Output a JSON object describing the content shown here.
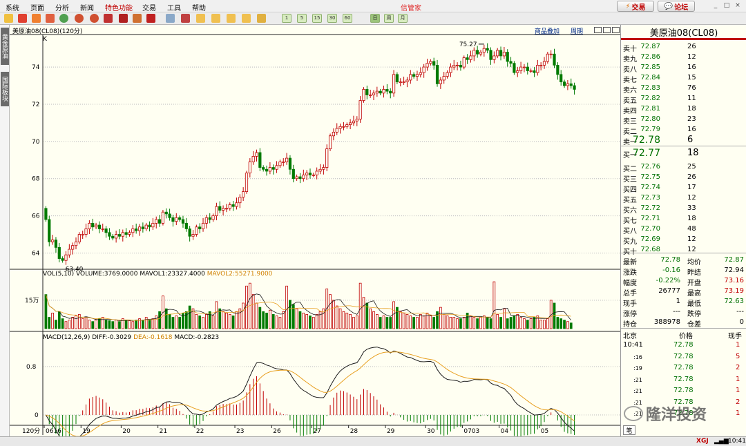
{
  "menu": {
    "items": [
      "系统",
      "页面",
      "分析",
      "新闻",
      "特色功能",
      "交易",
      "工具",
      "帮助"
    ],
    "brand": "信管家",
    "trade_btn": "交易",
    "forum_btn": "论坛",
    "win_controls": [
      "_",
      "□",
      "×"
    ]
  },
  "toolbar": {
    "period_buttons": [
      "1",
      "5",
      "15",
      "30",
      "60",
      "日",
      "周",
      "月"
    ],
    "icons": [
      "back-icon",
      "home-icon",
      "layers-icon",
      "stack-icon",
      "refresh-icon",
      "zoom-in-icon",
      "zoom-out-icon",
      "tv-icon",
      "pen-icon",
      "paint-icon",
      "funnel-icon",
      "table-icon",
      "chart-icon",
      "f10-icon",
      "list-icon",
      "news-icon",
      "doc-icon",
      "clock-icon"
    ]
  },
  "sidebar": {
    "tabs": [
      "黄金原油",
      "国际板块"
    ]
  },
  "chart": {
    "title": "美原油08(CL08)(120分)",
    "top_links": [
      "商品叠加",
      "周期"
    ],
    "k_label": "K",
    "period_label": "120分",
    "vol_legend_vol": "VOL(5,10)",
    "vol_legend_volume": "VOLUME:3769.0000",
    "vol_legend_mavol1": "MAVOL1:23327.4000",
    "vol_legend_mavol2": "MAVOL2:55271.9000",
    "macd_legend_title": "MACD(12,26,9)",
    "macd_legend_diff": "DIFF:-0.3029",
    "macd_legend_dea": "DEA:-0.1618",
    "macd_legend_macd": "MACD:-0.2823",
    "high_label": "75.27",
    "low_label": "63.40",
    "colors": {
      "up": "#c00000",
      "down": "#007a00",
      "ma1": "#1a1a1a",
      "ma2": "#e8a020"
    }
  },
  "chart_data": {
    "type": "candlestick",
    "ylim": [
      63.2,
      75.6
    ],
    "price_ticks": [
      "74",
      "72",
      "70",
      "68",
      "66",
      "64"
    ],
    "x_labels": [
      "0616",
      "19",
      "20",
      "21",
      "22",
      "23",
      "26",
      "27",
      "28",
      "29",
      "30",
      "0703",
      "04",
      "05"
    ],
    "volume_tick": "15万",
    "macd_ticks": [
      "0.8",
      "0"
    ],
    "close": [
      65.8,
      64.6,
      64.7,
      64.3,
      63.7,
      63.6,
      63.9,
      64.2,
      64.4,
      64.6,
      65.0,
      65.0,
      65.3,
      65.6,
      65.4,
      65.5,
      65.3,
      65.3,
      65.1,
      64.9,
      64.8,
      65.0,
      64.9,
      65.1,
      65.0,
      65.1,
      65.3,
      65.2,
      65.4,
      65.3,
      65.5,
      65.4,
      65.6,
      65.8,
      65.6,
      66.2,
      66.1,
      65.9,
      65.7,
      65.9,
      65.8,
      65.6,
      65.3,
      64.9,
      65.0,
      65.4,
      65.3,
      65.6,
      65.9,
      65.8,
      66.0,
      66.5,
      66.3,
      66.4,
      66.4,
      66.6,
      66.5,
      66.7,
      67.0,
      67.3,
      68.3,
      68.9,
      69.2,
      69.4,
      68.6,
      68.5,
      68.4,
      68.6,
      68.5,
      68.7,
      68.9,
      68.9,
      69.1,
      68.5,
      68.0,
      68.1,
      68.0,
      68.2,
      68.3,
      68.2,
      68.2,
      68.4,
      68.5,
      68.6,
      69.6,
      70.3,
      70.5,
      70.7,
      70.8,
      70.8,
      70.9,
      71.0,
      71.1,
      71.2,
      72.2,
      72.8,
      72.5,
      72.5,
      72.6,
      72.7,
      72.6,
      72.8,
      72.7,
      72.6,
      73.6,
      73.2,
      73.2,
      73.2,
      73.3,
      73.6,
      73.5,
      73.6,
      73.7,
      74.0,
      74.2,
      74.3,
      74.1,
      73.1,
      73.3,
      73.5,
      73.7,
      74.0,
      74.1,
      74.1,
      74.0,
      74.5,
      74.4,
      74.6,
      74.9,
      74.7,
      74.8,
      75.0,
      74.9,
      74.4,
      74.6,
      74.9,
      74.6,
      74.8,
      74.3,
      74.2,
      73.7,
      73.8,
      74.0,
      74.0,
      73.8,
      73.8,
      73.7,
      74.1,
      74.1,
      74.3,
      74.7,
      74.7,
      74.1,
      73.6,
      73.2,
      73.0,
      73.1,
      73.0,
      72.8
    ],
    "volume": [
      120,
      40,
      55,
      30,
      60,
      35,
      25,
      30,
      40,
      45,
      50,
      35,
      40,
      30,
      25,
      30,
      35,
      40,
      30,
      28,
      25,
      30,
      25,
      35,
      30,
      28,
      25,
      30,
      35,
      30,
      40,
      30,
      35,
      45,
      60,
      115,
      70,
      50,
      40,
      45,
      40,
      55,
      60,
      80,
      70,
      50,
      45,
      40,
      50,
      60,
      45,
      95,
      70,
      60,
      55,
      50,
      45,
      60,
      70,
      90,
      150,
      160,
      120,
      90,
      75,
      60,
      55,
      65,
      50,
      45,
      40,
      60,
      150,
      100,
      85,
      70,
      60,
      55,
      50,
      45,
      40,
      50,
      60,
      70,
      140,
      120,
      100,
      80,
      70,
      60,
      55,
      50,
      40,
      45,
      160,
      110,
      90,
      70,
      60,
      50,
      40,
      45,
      40,
      40,
      95,
      75,
      60,
      55,
      50,
      45,
      40,
      40,
      50,
      45,
      55,
      45,
      40,
      60,
      75,
      50,
      45,
      40,
      40,
      35,
      35,
      40,
      55,
      45,
      40,
      35,
      40,
      45,
      40,
      35,
      165,
      50,
      40,
      70,
      35,
      40,
      45,
      50,
      40,
      35,
      30,
      35,
      40,
      45,
      30,
      30,
      35,
      100,
      90,
      40,
      35,
      30,
      25,
      20
    ]
  },
  "quote": {
    "title": "美原油08(CL08)",
    "sell": [
      {
        "label": "卖十",
        "price": "72.87",
        "vol": "26"
      },
      {
        "label": "卖九",
        "price": "72.86",
        "vol": "12"
      },
      {
        "label": "卖八",
        "price": "72.85",
        "vol": "16"
      },
      {
        "label": "卖七",
        "price": "72.84",
        "vol": "15"
      },
      {
        "label": "卖六",
        "price": "72.83",
        "vol": "76"
      },
      {
        "label": "卖五",
        "price": "72.82",
        "vol": "11"
      },
      {
        "label": "卖四",
        "price": "72.81",
        "vol": "18"
      },
      {
        "label": "卖三",
        "price": "72.80",
        "vol": "23"
      },
      {
        "label": "卖二",
        "price": "72.79",
        "vol": "16"
      },
      {
        "label": "卖一",
        "price": "72.78",
        "vol": "6"
      }
    ],
    "buy": [
      {
        "label": "买一",
        "price": "72.77",
        "vol": "18"
      },
      {
        "label": "买二",
        "price": "72.76",
        "vol": "25"
      },
      {
        "label": "买三",
        "price": "72.75",
        "vol": "26"
      },
      {
        "label": "买四",
        "price": "72.74",
        "vol": "17"
      },
      {
        "label": "买五",
        "price": "72.73",
        "vol": "12"
      },
      {
        "label": "买六",
        "price": "72.72",
        "vol": "33"
      },
      {
        "label": "买七",
        "price": "72.71",
        "vol": "18"
      },
      {
        "label": "买八",
        "price": "72.70",
        "vol": "48"
      },
      {
        "label": "买九",
        "price": "72.69",
        "vol": "12"
      },
      {
        "label": "买十",
        "price": "72.68",
        "vol": "12"
      }
    ],
    "stats": [
      {
        "l1": "最新",
        "v1": "72.78",
        "c1": "green",
        "l2": "均价",
        "v2": "72.87",
        "c2": "green"
      },
      {
        "l1": "涨跌",
        "v1": "-0.16",
        "c1": "green",
        "l2": "昨结",
        "v2": "72.94",
        "c2": "black"
      },
      {
        "l1": "幅度",
        "v1": "-0.22%",
        "c1": "green",
        "l2": "开盘",
        "v2": "73.16",
        "c2": "red"
      },
      {
        "l1": "总手",
        "v1": "26777",
        "c1": "black",
        "l2": "最高",
        "v2": "73.19",
        "c2": "red"
      },
      {
        "l1": "现手",
        "v1": "1",
        "c1": "black",
        "l2": "最低",
        "v2": "72.63",
        "c2": "green"
      },
      {
        "l1": "涨停",
        "v1": "---",
        "c1": "black",
        "l2": "跌停",
        "v2": "---",
        "c2": "black"
      },
      {
        "l1": "持仓",
        "v1": "388978",
        "c1": "black",
        "l2": "仓差",
        "v2": "0",
        "c2": "black"
      }
    ],
    "ticks_header": {
      "city": "北京",
      "price": "价格",
      "qty": "现手"
    },
    "ticks": [
      {
        "time": "10:41",
        "price": "72.78",
        "qty": "1",
        "qc": "red"
      },
      {
        "time": ":16",
        "price": "72.78",
        "qty": "5",
        "qc": "red"
      },
      {
        "time": ":19",
        "price": "72.78",
        "qty": "2",
        "qc": "red"
      },
      {
        "time": ":21",
        "price": "72.78",
        "qty": "1",
        "qc": "red"
      },
      {
        "time": ":21",
        "price": "72.78",
        "qty": "1",
        "qc": "red"
      },
      {
        "time": ":21",
        "price": "72.78",
        "qty": "2",
        "qc": "red"
      },
      {
        "time": ":21",
        "price": "72.78",
        "qty": "1",
        "qc": "red"
      }
    ],
    "bottom_tab": "笔",
    "watermark": "隆洋投资"
  },
  "status": {
    "brand": "XGJ",
    "time": "10:41"
  }
}
